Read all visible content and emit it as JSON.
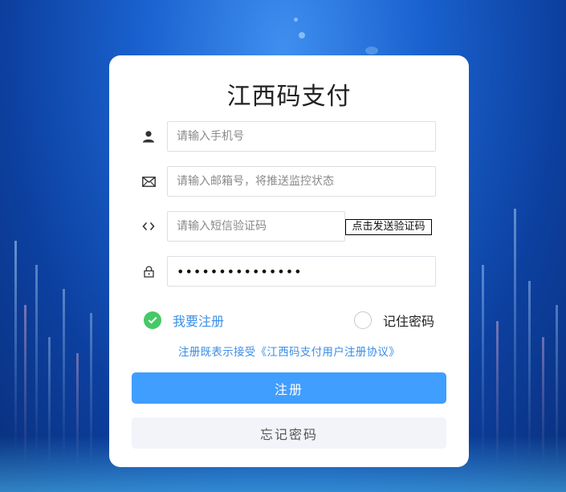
{
  "app": {
    "title": "江西码支付"
  },
  "form": {
    "phone_placeholder": "请输入手机号",
    "email_placeholder": "请输入邮箱号，将推送监控状态",
    "sms_placeholder": "请输入短信验证码",
    "send_code_label": "点击发送验证码",
    "password_value": "•••••••••••••••"
  },
  "options": {
    "register_label": "我要注册",
    "register_checked": true,
    "remember_label": "记住密码",
    "remember_checked": false
  },
  "agreement_text": "注册既表示接受《江西码支付用户注册协议》",
  "buttons": {
    "register_label": "注册",
    "forgot_label": "忘记密码"
  },
  "icons": {
    "phone": "user-icon",
    "email": "envelope-icon",
    "sms": "code-brackets-icon",
    "password": "lock-icon",
    "register_check": "check-circle-icon",
    "remember_check": "empty-circle-icon"
  },
  "colors": {
    "accent": "#409eff",
    "link": "#3a8ee6",
    "check": "#45c965",
    "secondary_btn": "#f2f4fa"
  }
}
